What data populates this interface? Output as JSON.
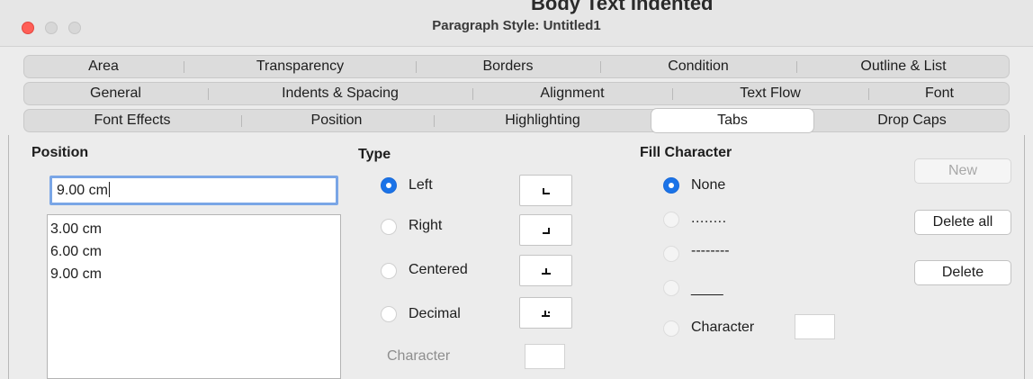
{
  "window": {
    "title": "Paragraph Style: Untitled1",
    "background_text": "Body Text Indented"
  },
  "tabs": {
    "row1": [
      "Area",
      "Transparency",
      "Borders",
      "Condition",
      "Outline & List"
    ],
    "row2": [
      "General",
      "Indents & Spacing",
      "Alignment",
      "Text Flow",
      "Font"
    ],
    "row3": [
      "Font Effects",
      "Position",
      "Highlighting",
      "Tabs",
      "Drop Caps"
    ],
    "active": "Tabs"
  },
  "position": {
    "label": "Position",
    "input_value": "9.00 cm",
    "list": [
      "3.00 cm",
      "6.00 cm",
      "9.00 cm"
    ]
  },
  "type": {
    "label": "Type",
    "options": [
      "Left",
      "Right",
      "Centered",
      "Decimal"
    ],
    "selected": "Left",
    "character_label": "Character"
  },
  "fill": {
    "label": "Fill Character",
    "options": [
      "None",
      "........",
      "--------",
      "____",
      "Character"
    ],
    "selected": "None"
  },
  "buttons": {
    "new": "New",
    "delete_all": "Delete all",
    "delete": "Delete"
  },
  "colors": {
    "accent": "#1a73e8",
    "close": "#ff5f57"
  }
}
